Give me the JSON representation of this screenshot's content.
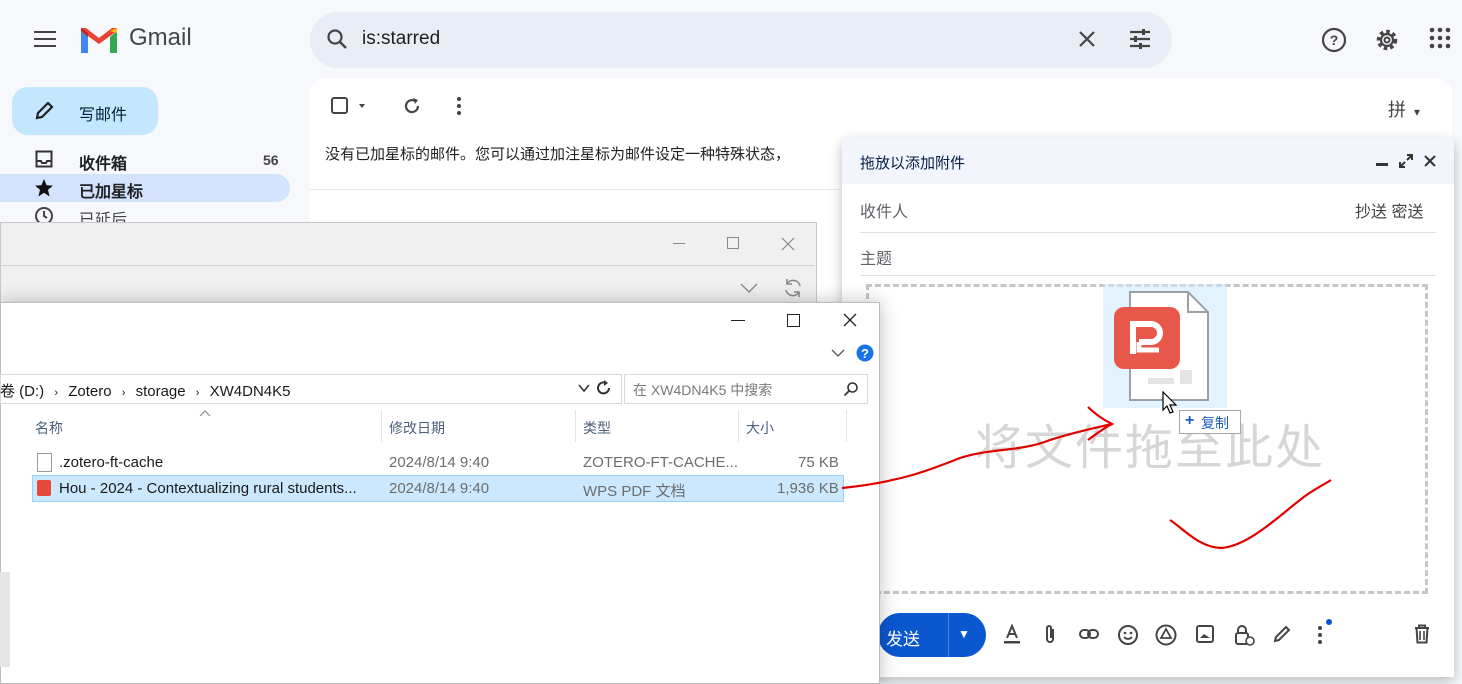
{
  "header": {
    "brand": "Gmail",
    "search_value": "is:starred"
  },
  "sidebar": {
    "compose_label": "写邮件",
    "items": [
      {
        "label": "收件箱",
        "count": "56"
      },
      {
        "label": "已加星标",
        "count": ""
      },
      {
        "label": "已延后",
        "count": ""
      }
    ]
  },
  "main": {
    "empty_message": "没有已加星标的邮件。您可以通过加注星标为邮件设定一种特殊状态，",
    "input_method": "拼"
  },
  "compose": {
    "title": "拖放以添加附件",
    "to_label": "收件人",
    "cc_bcc_label": "抄送 密送",
    "subject_label": "主题",
    "drop_text": "将文件拖至此处",
    "send_label": "发送",
    "copy_tooltip": "复制"
  },
  "explorer": {
    "path": [
      "卷 (D:)",
      "Zotero",
      "storage",
      "XW4DN4K5"
    ],
    "search_placeholder": "在 XW4DN4K5 中搜索",
    "columns": [
      "名称",
      "修改日期",
      "类型",
      "大小"
    ],
    "files": [
      {
        "name": ".zotero-ft-cache",
        "date": "2024/8/14 9:40",
        "type": "ZOTERO-FT-CACHE...",
        "size": "75 KB"
      },
      {
        "name": "Hou - 2024 - Contextualizing rural students...",
        "date": "2024/8/14 9:40",
        "type": "WPS PDF 文档",
        "size": "1,936 KB"
      }
    ]
  },
  "colors": {
    "accent": "#0b57d0",
    "compose_bg": "#c2e7ff",
    "selected_row": "#cce8ff",
    "annotation": "#e00000"
  }
}
